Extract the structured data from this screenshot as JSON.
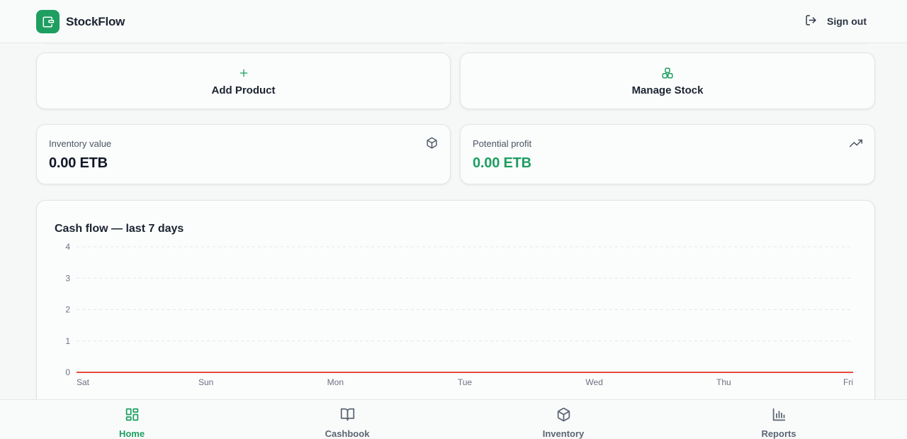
{
  "header": {
    "brand": "StockFlow",
    "sign_out_label": "Sign out"
  },
  "actions": [
    {
      "label": "Add Product",
      "icon": "plus-icon"
    },
    {
      "label": "Manage Stock",
      "icon": "boxes-icon"
    }
  ],
  "stats": [
    {
      "label": "Inventory value",
      "value": "0.00 ETB",
      "icon": "package-icon",
      "value_color": "#111827"
    },
    {
      "label": "Potential profit",
      "value": "0.00 ETB",
      "icon": "trending-up-icon",
      "value_color": "#1e9e61"
    }
  ],
  "chart_data": {
    "type": "line",
    "title": "Cash flow — last 7 days",
    "categories": [
      "Sat",
      "Sun",
      "Mon",
      "Tue",
      "Wed",
      "Thu",
      "Fri"
    ],
    "series": [
      {
        "values": [
          0,
          0,
          0,
          0,
          0,
          0,
          0
        ],
        "color": "#e74c3c"
      }
    ],
    "yticks": [
      0,
      1,
      2,
      3,
      4
    ],
    "ylim": [
      0,
      4
    ],
    "grid": true,
    "grid_style": "dashed"
  },
  "nav": [
    {
      "label": "Home",
      "icon": "home-grid-icon",
      "active": true
    },
    {
      "label": "Cashbook",
      "icon": "book-icon",
      "active": false
    },
    {
      "label": "Inventory",
      "icon": "package-icon",
      "active": false
    },
    {
      "label": "Reports",
      "icon": "bar-chart-icon",
      "active": false
    }
  ],
  "colors": {
    "accent": "#1e9e61",
    "background": "#f6f8f7",
    "line": "#e74c3c"
  }
}
